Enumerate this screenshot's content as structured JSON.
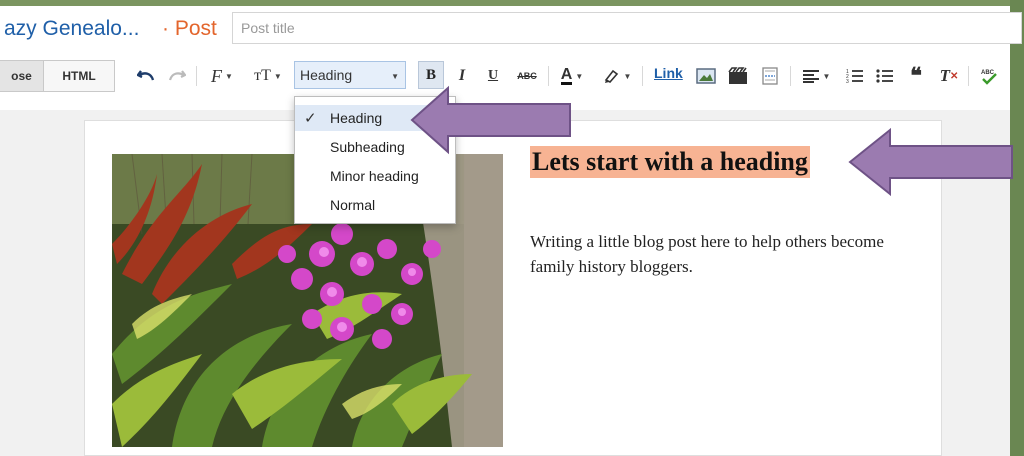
{
  "header": {
    "blog_title": "azy Genealo...",
    "post_label": "· Post",
    "post_title_placeholder": "Post title"
  },
  "toolbar": {
    "compose_label": "ose",
    "html_label": "HTML",
    "heading_value": "Heading",
    "bold_label": "B",
    "italic_label": "I",
    "underline_label": "U",
    "strike_label": "ABC",
    "text_color_label": "A",
    "link_label": "Link",
    "font_icon_label": "F",
    "font_size_label": "тT",
    "clear_format_label": "T"
  },
  "dropdown": {
    "items": [
      {
        "label": "Heading",
        "selected": true
      },
      {
        "label": "Subheading",
        "selected": false
      },
      {
        "label": "Minor heading",
        "selected": false
      },
      {
        "label": "Normal",
        "selected": false
      }
    ],
    "checkmark": "✓"
  },
  "document": {
    "heading": "Lets start with a heading",
    "body": "Writing a little blog post here to help others become family history bloggers.",
    "heading_highlight_color": "#f7b393"
  },
  "annotations": {
    "arrow_color": "#9b7bb0"
  }
}
